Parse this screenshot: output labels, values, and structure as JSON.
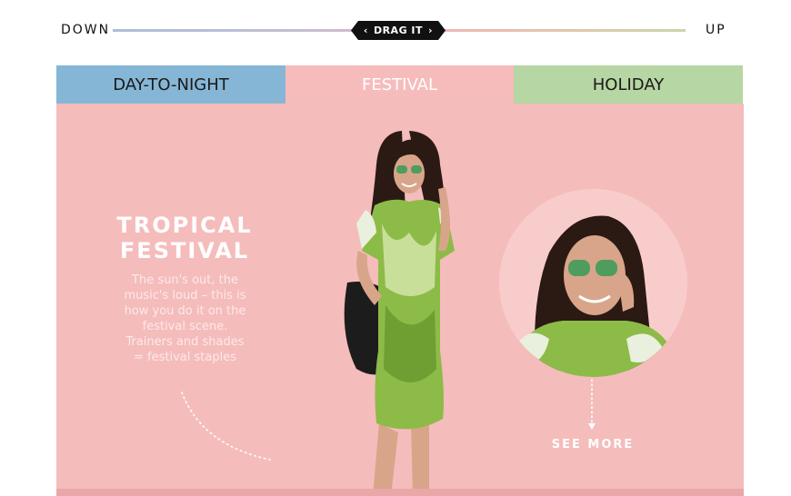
{
  "slider": {
    "left_label": "DOWN",
    "right_label": "UP",
    "handle_label": "DRAG IT",
    "handle_left_icon": "chevron-left-icon",
    "handle_right_icon": "chevron-right-icon"
  },
  "tabs": [
    {
      "label": "DAY-TO-NIGHT",
      "color": "#86b6d6"
    },
    {
      "label": "FESTIVAL",
      "color": "#f6bcbc",
      "active": true
    },
    {
      "label": "HOLIDAY",
      "color": "#b6d6a3"
    }
  ],
  "panel": {
    "background": "#f5bcbc",
    "headline_line1": "TROPICAL",
    "headline_line2": "FESTIVAL",
    "body_lines": [
      "The sun's out, the",
      "music's loud – this is",
      "how you do it on the",
      "festival scene.",
      "Trainers and shades",
      "= festival staples"
    ],
    "see_more": "SEE MORE"
  }
}
